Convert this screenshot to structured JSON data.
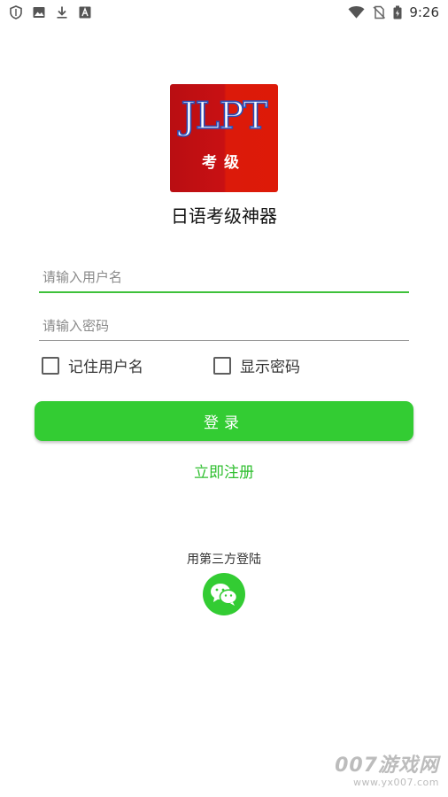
{
  "status_bar": {
    "time": "9:26",
    "left_icons": [
      "shield-icon",
      "image-icon",
      "download-icon",
      "font-icon"
    ],
    "right_icons": [
      "wifi-icon",
      "no-sim-icon",
      "battery-icon"
    ]
  },
  "app": {
    "logo_text": "JLPT",
    "logo_sub": "考级",
    "name": "日语考级神器"
  },
  "form": {
    "username_placeholder": "请输入用户名",
    "username_value": "",
    "password_placeholder": "请输入密码",
    "password_value": "",
    "remember_label": "记住用户名",
    "show_password_label": "显示密码",
    "remember_checked": false,
    "show_password_checked": false
  },
  "actions": {
    "login_label": "登录",
    "register_label": "立即注册",
    "third_party_label": "用第三方登陆",
    "wechat_icon": "wechat-icon"
  },
  "colors": {
    "accent_green": "#33cc33",
    "logo_red": "#c81013"
  },
  "watermark": {
    "title": "007游戏网",
    "url": "www.yx007.com"
  }
}
